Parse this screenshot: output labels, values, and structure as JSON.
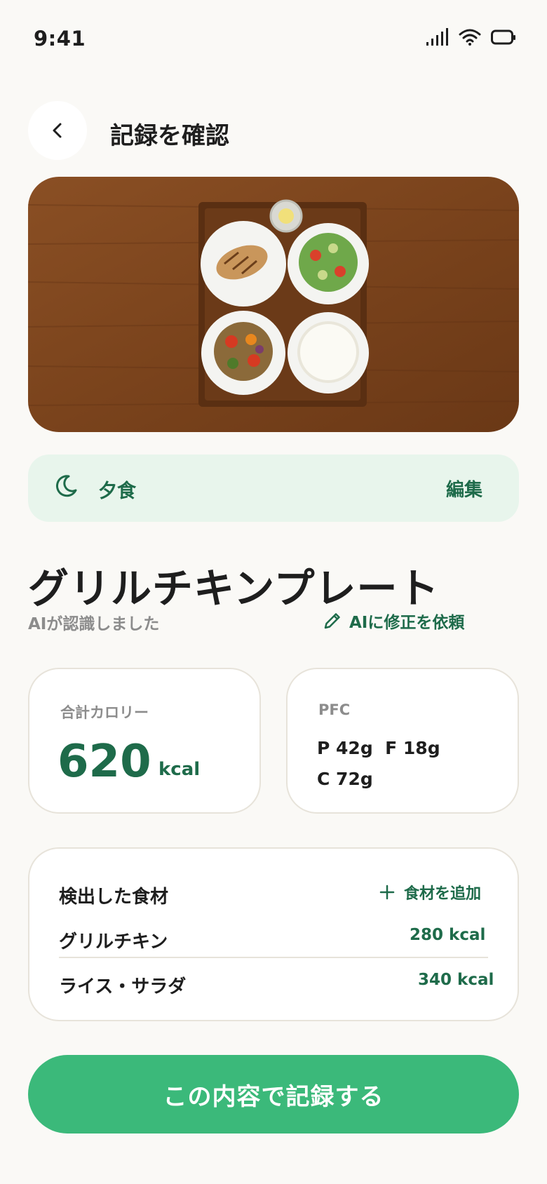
{
  "status_bar": {
    "time": "9:41"
  },
  "header": {
    "title": "記録を確認"
  },
  "meal": {
    "label": "夕食",
    "edit_label": "編集"
  },
  "dish": {
    "name": "グリルチキンプレート",
    "ai_note": "AIが認識しました",
    "ai_fix_label": "AIに修正を依頼"
  },
  "calorie_card": {
    "label": "合計カロリー",
    "value": "620",
    "unit": "kcal"
  },
  "pfc_card": {
    "label": "PFC",
    "line1": "P 42g  F 18g",
    "line2": "C 72g"
  },
  "ingredients": {
    "title": "検出した食材",
    "add_label": "食材を追加",
    "items": [
      {
        "name": "グリルチキン",
        "kcal": "280 kcal"
      },
      {
        "name": "ライス・サラダ",
        "kcal": "340 kcal"
      }
    ]
  },
  "record_button": {
    "label": "この内容で記録する"
  },
  "colors": {
    "background": "#FAF9F6",
    "accent_dark": "#1E6B4A",
    "accent_button": "#3BB97A",
    "meal_bar": "#E8F5EC"
  }
}
